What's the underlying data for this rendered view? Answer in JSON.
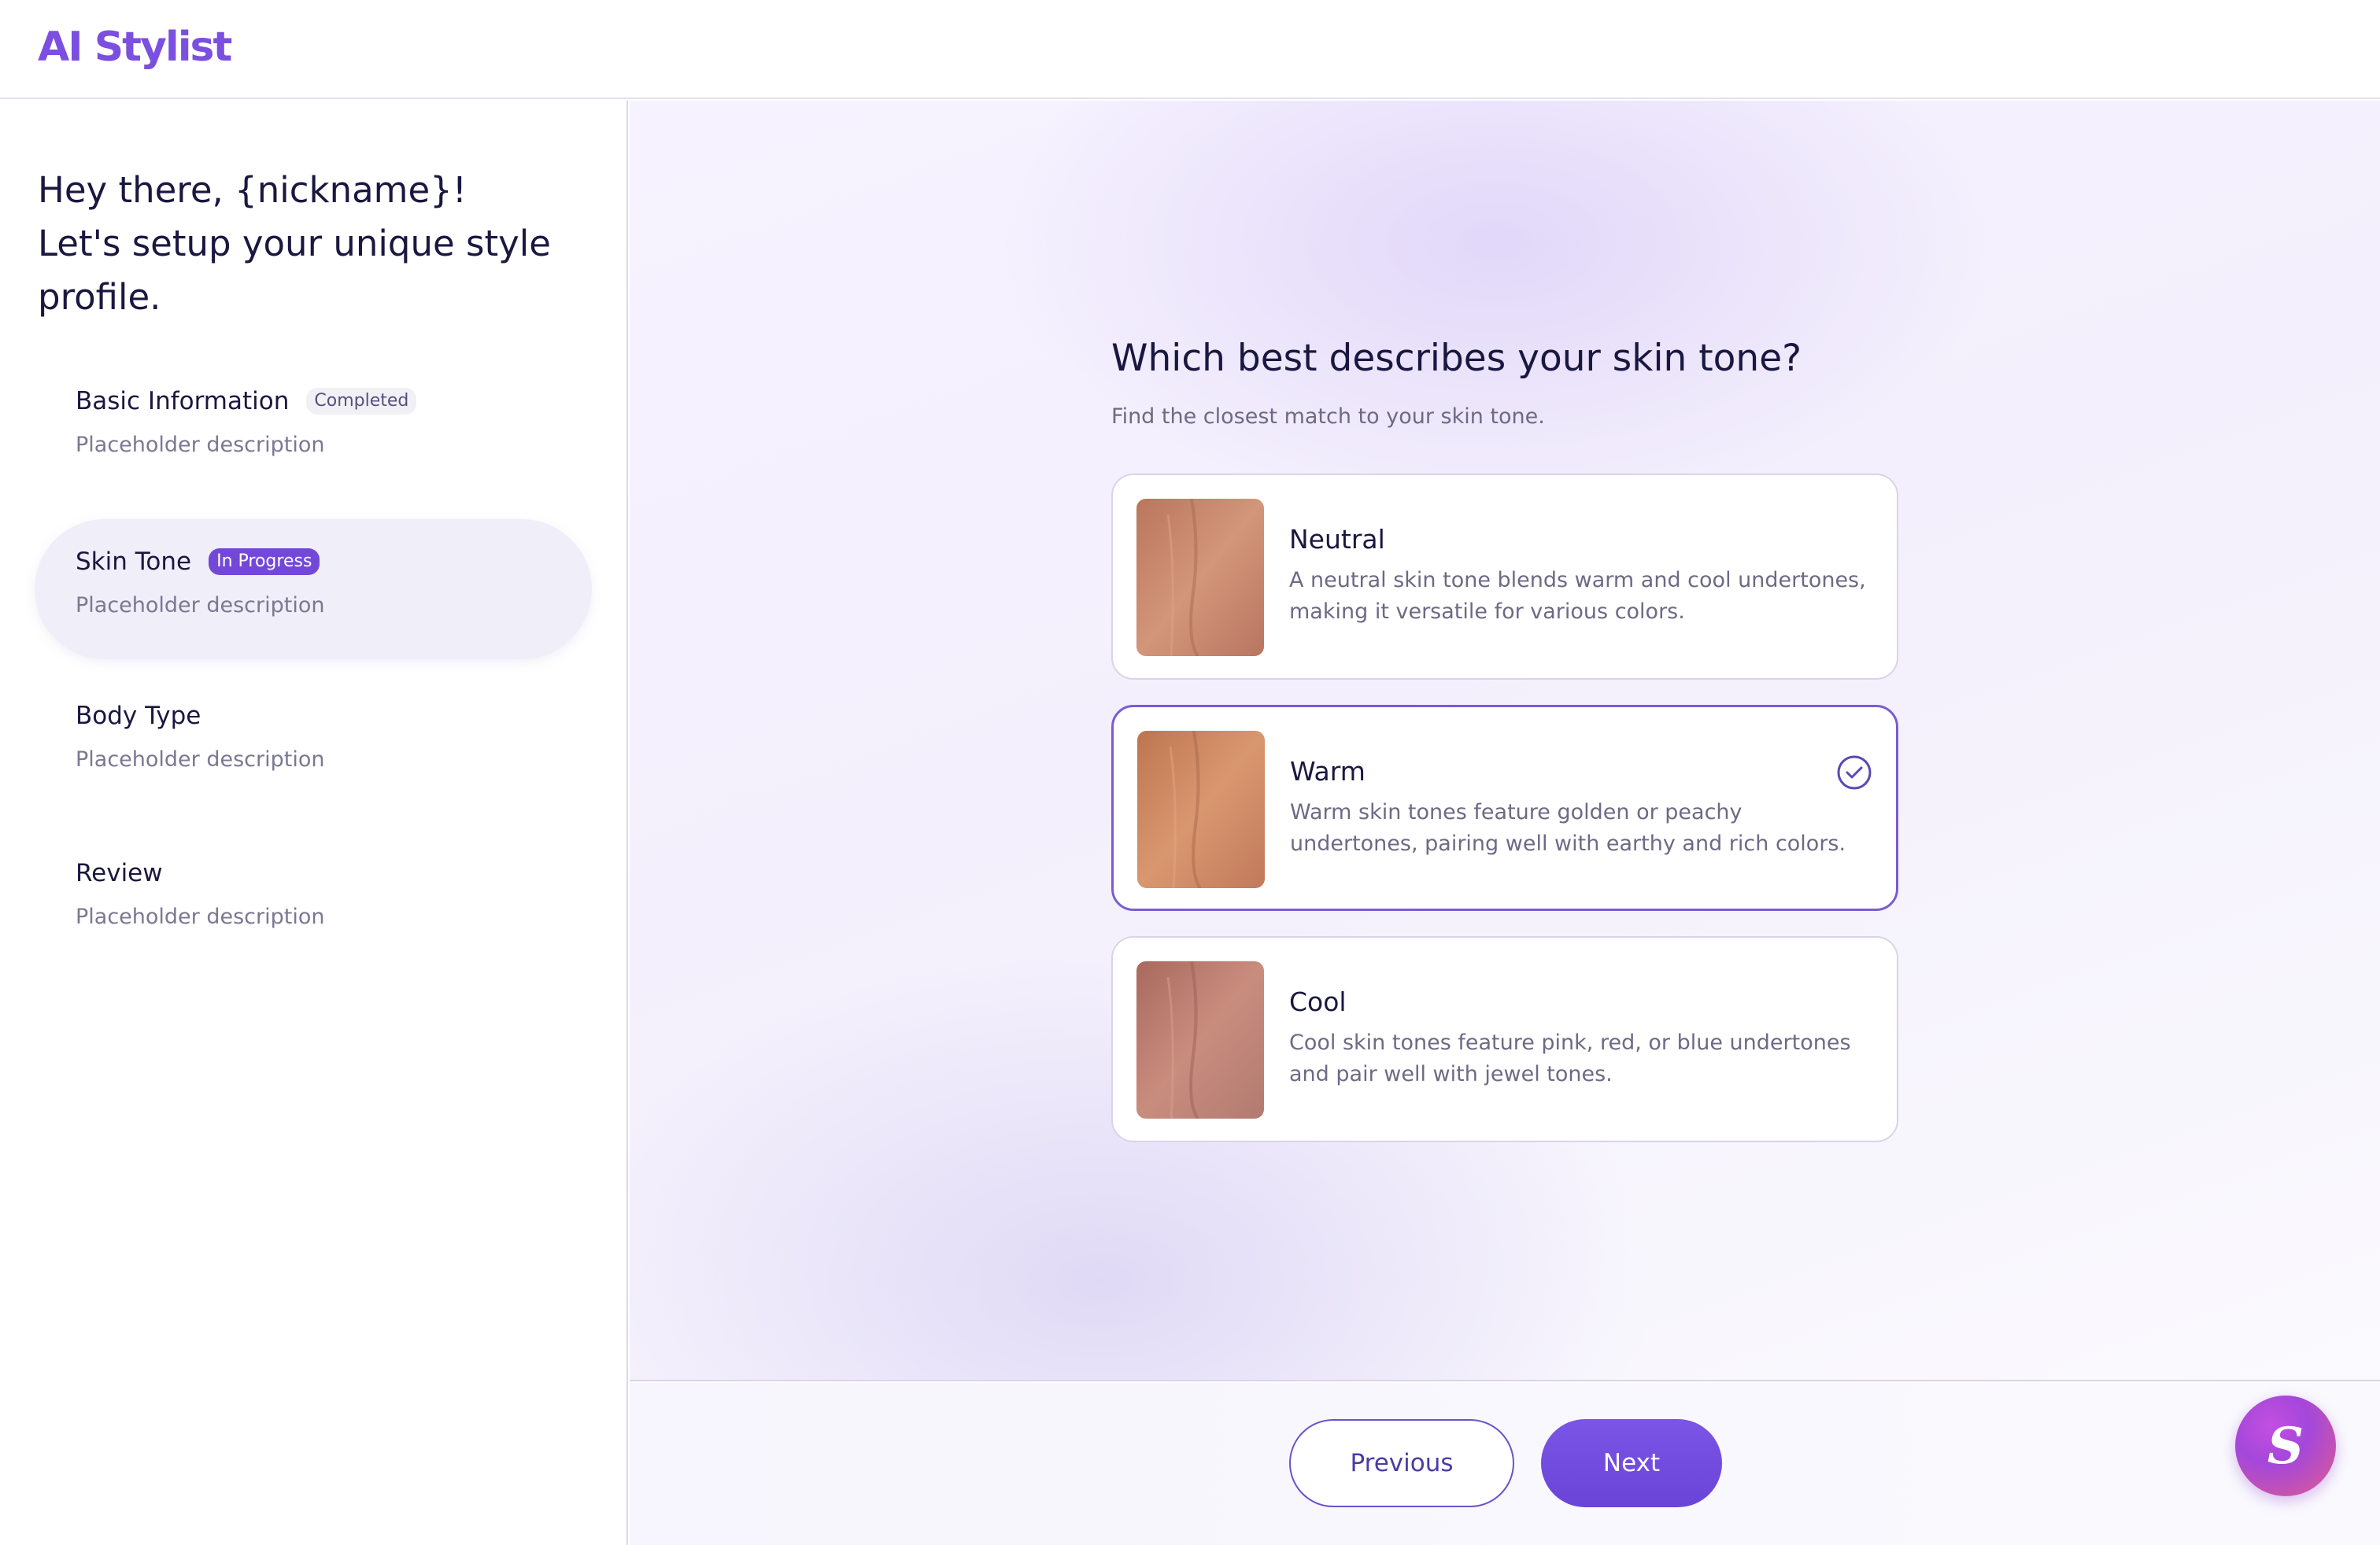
{
  "app": {
    "logo": "AI Stylist"
  },
  "sidebar": {
    "greeting_line1": "Hey there, {nickname}!",
    "greeting_line2": "Let's setup your unique style",
    "greeting_line3": "profile.",
    "steps": [
      {
        "name": "Basic Information",
        "badge": "Completed",
        "description": "Placeholder description"
      },
      {
        "name": "Skin Tone",
        "badge": "In Progress",
        "description": "Placeholder description"
      },
      {
        "name": "Body Type",
        "badge": "",
        "description": "Placeholder description"
      },
      {
        "name": "Review",
        "badge": "",
        "description": "Placeholder description"
      }
    ]
  },
  "main": {
    "question": "Which best describes your skin tone?",
    "subtitle": "Find the closest match to your skin tone.",
    "options": [
      {
        "title": "Neutral",
        "description": "A neutral skin tone blends warm and cool undertones, making it versatile for various colors.",
        "swatch_color": "#c98a6e",
        "selected": false
      },
      {
        "title": "Warm",
        "description": "Warm skin tones feature golden or peachy undertones, pairing well with earthy and rich colors.",
        "swatch_color": "#d08a62",
        "selected": true
      },
      {
        "title": "Cool",
        "description": "Cool skin tones feature pink, red, or blue undertones and pair well with jewel tones.",
        "swatch_color": "#c08474",
        "selected": false
      }
    ]
  },
  "footer": {
    "previous_label": "Previous",
    "next_label": "Next",
    "assistant_glyph": "S"
  },
  "colors": {
    "accent": "#7348d8",
    "text": "#1a1740",
    "muted": "#6d6a85"
  }
}
